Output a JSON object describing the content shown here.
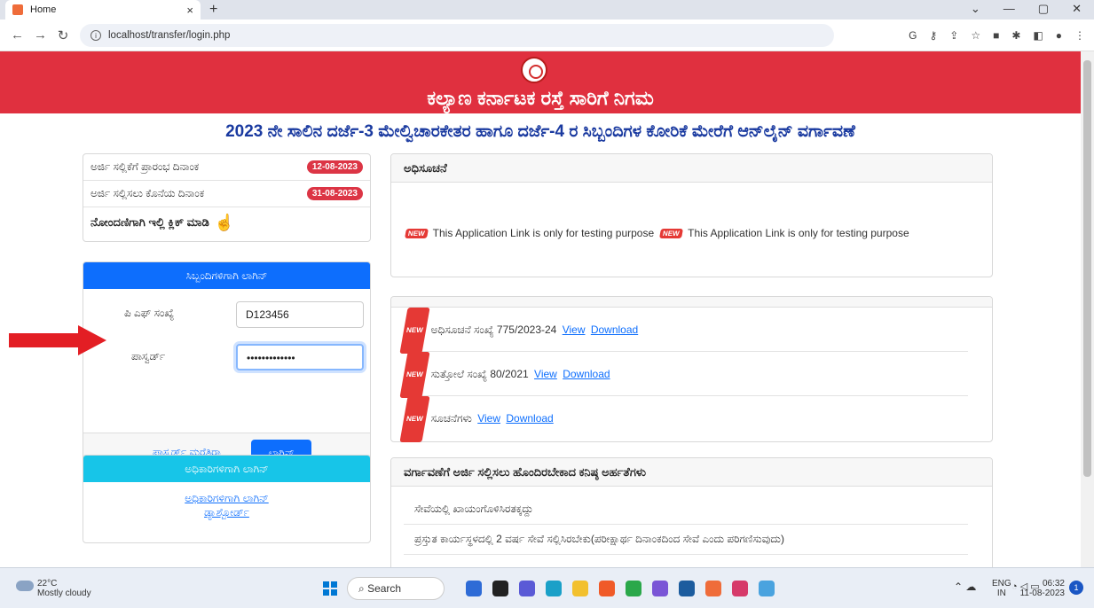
{
  "browser": {
    "tab_title": "Home",
    "url": "localhost/transfer/login.php",
    "colors": {
      "tabbar": "#dfe3eb"
    }
  },
  "page": {
    "org_title": "ಕಲ್ಯಾಣ ಕರ್ನಾಟಕ ರಸ್ತೆ ಸಾರಿಗೆ ನಿಗಮ",
    "subtitle": "2023 ನೇ ಸಾಲಿನ ದರ್ಜೆ-3 ಮೇಲ್ವಿಚಾರಕೇತರ ಹಾಗೂ ದರ್ಜೆ-4 ರ ಸಿಬ್ಬಂದಿಗಳ ಕೋರಿಕೆ ಮೇರೆಗೆ ಆನ್‌ಲೈನ್ ವರ್ಗಾವಣೆ",
    "colors": {
      "banner": "#e0303f",
      "subtitle": "#1a3aa0",
      "primary": "#0d6efd",
      "officer": "#17c5e8",
      "badge": "#dc3545"
    }
  },
  "dates": {
    "start_label": "ಅರ್ಜಿ ಸಲ್ಲಿಕೆಗೆ ಪ್ರಾರಂಭ ದಿನಾಂಕ",
    "start_date": "12-08-2023",
    "end_label": "ಅರ್ಜಿ ಸಲ್ಲಿಸಲು ಕೊನೆಯ ದಿನಾಂಕ",
    "end_date": "31-08-2023",
    "register_label": "ನೋಂದಣಿಗಾಗಿ ಇಲ್ಲಿ ಕ್ಲಿಕ್ ಮಾಡಿ",
    "register_icon": "pointing-hand-icon"
  },
  "staff_login": {
    "title": "ಸಿಬ್ಬಂದಿಗಳಿಗಾಗಿ ಲಾಗಿನ್",
    "pf_label": "ಪಿ ಎಫ್ ಸಂಖ್ಯೆ",
    "pf_value": "D123456",
    "password_label": "ಪಾಸ್ವರ್ಡ್",
    "password_value": "•••••••••••••",
    "forgot_link": "ಪಾಸ್ವರ್ಡ್ ಮರೆತಿರಾ",
    "login_button": "ಲಾಗಿನ್"
  },
  "officer_login": {
    "title": "ಅಧಿಕಾರಿಗಳಿಗಾಗಿ ಲಾಗಿನ್",
    "link1": "ಅಧಿಕಾರಿಗಳಿಗಾಗಿ ಲಾಗಿನ್",
    "link2": "ಡ್ಯಾಶ್ಬೋರ್ಡ್"
  },
  "notice_card": {
    "title": "ಅಧಿಸೂಚನೆ",
    "new_tag": "NEW",
    "message": "This Application Link is only for testing purpose"
  },
  "documents": [
    {
      "label": "ಅಧಿಸೂಚನೆ ಸಂಖ್ಯೆ 775/2023-24",
      "view": "View",
      "download": "Download"
    },
    {
      "label": "ಸುತ್ತೋಲೆ ಸಂಖ್ಯೆ 80/2021",
      "view": "View",
      "download": "Download"
    },
    {
      "label": "ಸೂಚನೆಗಳು",
      "view": "View",
      "download": "Download"
    }
  ],
  "eligibility": {
    "title": "ವರ್ಗಾವಣೆಗೆ ಅರ್ಜಿ ಸಲ್ಲಿಸಲು ಹೊಂದಿರಬೇಕಾದ ಕನಿಷ್ಠ ಅರ್ಹತೆಗಳು",
    "items": [
      "ಸೇವೆಯಲ್ಲಿ ಖಾಯಂಗೊಳಿಸಿರತಕ್ಕದ್ದು",
      "ಪ್ರಸ್ತುತ ಕಾರ್ಯಸ್ಥಳದಲ್ಲಿ 2 ವರ್ಷ ಸೇವೆ ಸಲ್ಲಿಸಿರಬೇಕು(ಪರೀಕ್ಷಾರ್ಥ ದಿನಾಂಕದಿಂದ ಸೇವೆ ಎಂದು ಪರಿಗಣಿಸುವುದು)"
    ]
  },
  "taskbar": {
    "temperature": "22°C",
    "weather": "Mostly cloudy",
    "search": "Search",
    "lang1": "ENG",
    "lang2": "IN",
    "time": "06:32",
    "date": "11-08-2023",
    "notifications": "1"
  }
}
